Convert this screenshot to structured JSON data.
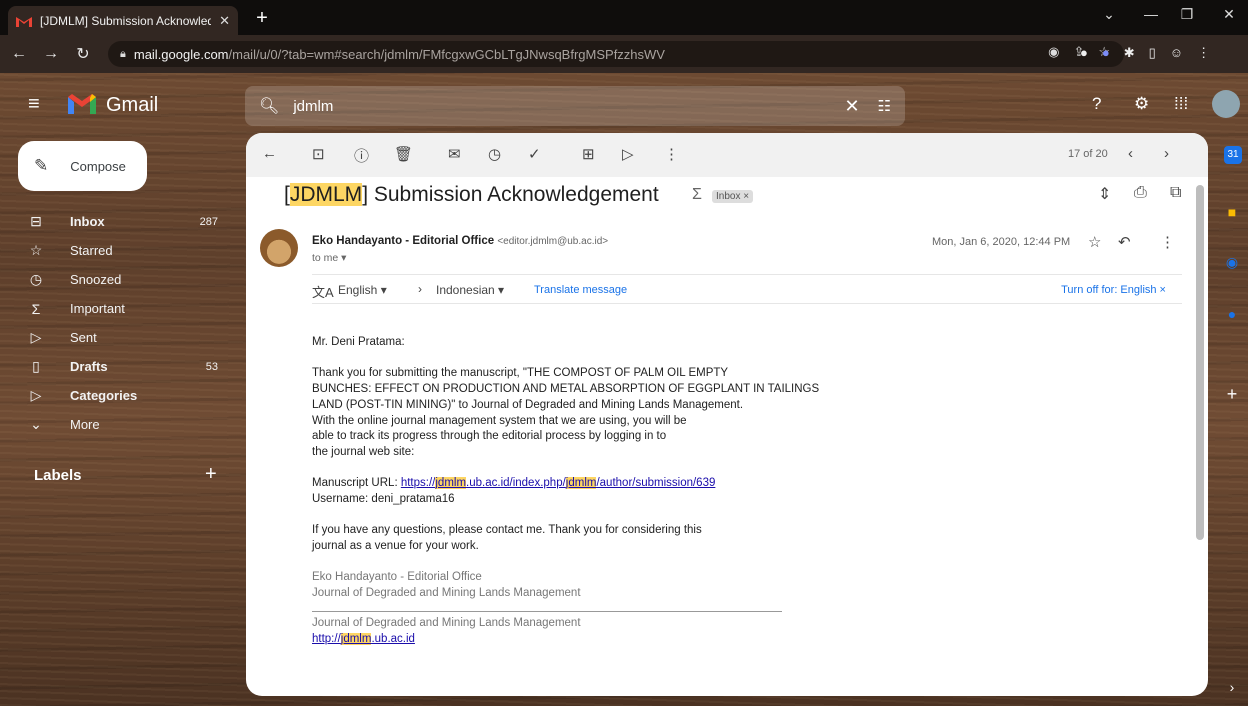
{
  "browser": {
    "tab_title": "[JDMLM] Submission Acknowledge",
    "tab_close": "✕",
    "new_tab": "+",
    "url_host": "mail.google.com",
    "url_path": "/mail/u/0/?tab=wm#search/jdmlm/FMfcgxwGCbLTgJNwsqBfrgMSPfzzhsWV"
  },
  "gmail": {
    "app_name": "Gmail",
    "search_value": "jdmlm",
    "compose_label": "Compose",
    "nav": [
      {
        "label": "Inbox",
        "count": "287",
        "icon": "inbox-icon"
      },
      {
        "label": "Starred",
        "count": "",
        "icon": "star-icon"
      },
      {
        "label": "Snoozed",
        "count": "",
        "icon": "clock-icon"
      },
      {
        "label": "Important",
        "count": "",
        "icon": "important-icon"
      },
      {
        "label": "Sent",
        "count": "",
        "icon": "send-icon"
      },
      {
        "label": "Drafts",
        "count": "53",
        "icon": "draft-icon"
      },
      {
        "label": "Categories",
        "count": "",
        "icon": "label-icon"
      },
      {
        "label": "More",
        "count": "",
        "icon": "chevron-down-icon"
      }
    ],
    "labels_heading": "Labels",
    "labels_add": "+"
  },
  "message": {
    "counter": "17 of 20",
    "subject_highlight": "JDMLM",
    "subject_rest": " Submission Acknowledgement",
    "inbox_chip": "Inbox ×",
    "sender_name": "Eko Handayanto - Editorial Office",
    "sender_email": "<editor.jdmlm@ub.ac.id>",
    "to": "to me ▾",
    "date": "Mon, Jan 6, 2020, 12:44 PM",
    "translate": {
      "from": "English ▾",
      "to": "Indonesian ▾",
      "link": "Translate message",
      "turn_off": "Turn off for: English ×"
    },
    "body": {
      "greeting": "Mr. Deni Pratama:",
      "para1_l1": "Thank you for submitting the manuscript, \"THE COMPOST OF PALM OIL EMPTY",
      "para1_l2": "BUNCHES: EFFECT ON PRODUCTION AND METAL ABSORPTION OF EGGPLANT IN TAILINGS",
      "para1_l3": "LAND (POST-TIN MINING)\" to Journal of Degraded and Mining Lands Management.",
      "para1_l4": "With the online journal management system that we are using, you will be",
      "para1_l5": "able to track its progress through the editorial process by logging in to",
      "para1_l6": "the journal web site:",
      "url_label": "Manuscript URL: ",
      "url_a": "https://",
      "url_b": "jdmlm",
      "url_c": ".ub.ac.id/index.php/",
      "url_d": "jdmlm",
      "url_e": "/author/submission/639",
      "username": "Username: deni_pratama16",
      "para2_l1": "If you have any questions, please contact me. Thank you for considering this",
      "para2_l2": "journal as a venue for your work.",
      "sig1": "Eko Handayanto - Editorial Office",
      "sig2": "Journal of Degraded and Mining Lands Management",
      "footer_journal": "Journal of Degraded and Mining Lands Management",
      "footer_a": "http://",
      "footer_b": "jdmlm",
      "footer_c": ".ub.ac.id"
    }
  }
}
